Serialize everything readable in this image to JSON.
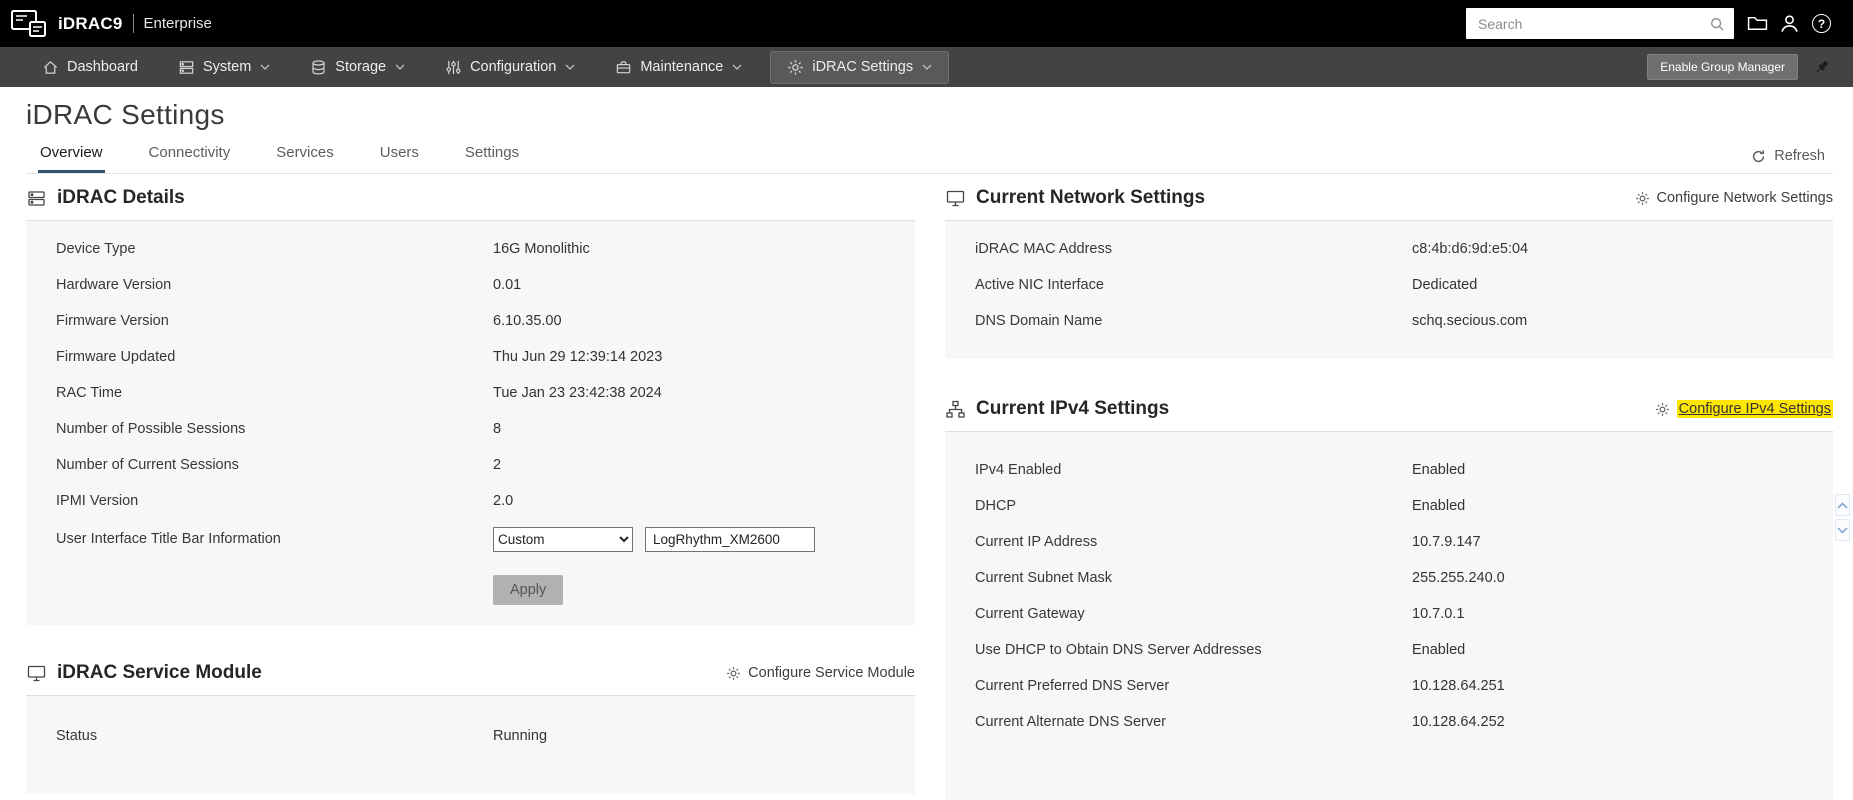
{
  "header": {
    "brand": "iDRAC9",
    "edition": "Enterprise",
    "search_placeholder": "Search"
  },
  "nav": {
    "items": [
      {
        "label": "Dashboard"
      },
      {
        "label": "System"
      },
      {
        "label": "Storage"
      },
      {
        "label": "Configuration"
      },
      {
        "label": "Maintenance"
      },
      {
        "label": "iDRAC Settings"
      }
    ],
    "active_item": "iDRAC Settings",
    "enable_group_manager_label": "Enable Group Manager"
  },
  "page": {
    "title": "iDRAC Settings",
    "tabs": [
      "Overview",
      "Connectivity",
      "Services",
      "Users",
      "Settings"
    ],
    "active_tab": "Overview",
    "refresh_label": "Refresh"
  },
  "idrac_details": {
    "title": "iDRAC Details",
    "rows": [
      {
        "label": "Device Type",
        "value": "16G Monolithic"
      },
      {
        "label": "Hardware Version",
        "value": "0.01"
      },
      {
        "label": "Firmware Version",
        "value": "6.10.35.00"
      },
      {
        "label": "Firmware Updated",
        "value": "Thu Jun 29 12:39:14 2023"
      },
      {
        "label": "RAC Time",
        "value": "Tue Jan 23 23:42:38 2024"
      },
      {
        "label": "Number of Possible Sessions",
        "value": "8"
      },
      {
        "label": "Number of Current Sessions",
        "value": "2"
      },
      {
        "label": "IPMI Version",
        "value": "2.0"
      }
    ],
    "title_bar_label": "User Interface Title Bar Information",
    "title_bar_select_value": "Custom",
    "title_bar_input_value": "LogRhythm_XM2600",
    "apply_label": "Apply"
  },
  "service_module": {
    "title": "iDRAC Service Module",
    "configure_label": "Configure Service Module",
    "rows": [
      {
        "label": "Status",
        "value": "Running"
      }
    ]
  },
  "network_settings": {
    "title": "Current Network Settings",
    "configure_label": "Configure Network Settings",
    "rows": [
      {
        "label": "iDRAC MAC Address",
        "value": "c8:4b:d6:9d:e5:04"
      },
      {
        "label": "Active NIC Interface",
        "value": "Dedicated"
      },
      {
        "label": "DNS Domain Name",
        "value": "schq.secious.com"
      }
    ]
  },
  "ipv4_settings": {
    "title": "Current IPv4 Settings",
    "configure_label": "Configure IPv4 Settings",
    "configure_highlighted": true,
    "rows": [
      {
        "label": "IPv4 Enabled",
        "value": "Enabled"
      },
      {
        "label": "DHCP",
        "value": "Enabled"
      },
      {
        "label": "Current IP Address",
        "value": "10.7.9.147"
      },
      {
        "label": "Current Subnet Mask",
        "value": "255.255.240.0"
      },
      {
        "label": "Current Gateway",
        "value": "10.7.0.1"
      },
      {
        "label": "Use DHCP to Obtain DNS Server Addresses",
        "value": "Enabled"
      },
      {
        "label": "Current Preferred DNS Server",
        "value": "10.128.64.251"
      },
      {
        "label": "Current Alternate DNS Server",
        "value": "10.128.64.252"
      }
    ]
  },
  "colors": {
    "topbar_bg": "#000000",
    "nav_bg": "#434343",
    "nav_active_bg": "#595959",
    "card_body_bg": "#f7f7f7",
    "tab_active_underline": "#33506b",
    "search_highlight": "#ffe600",
    "apply_button_bg": "#b1b1b1"
  }
}
